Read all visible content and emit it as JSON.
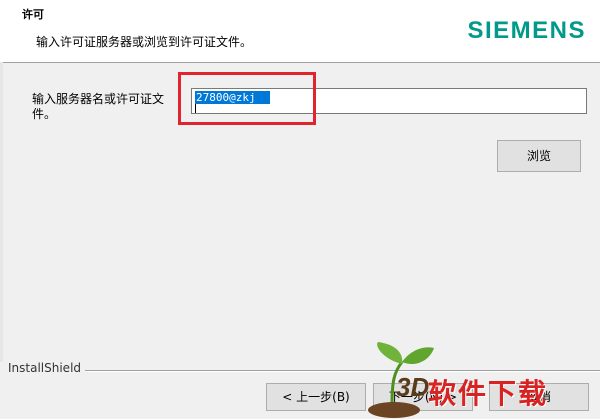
{
  "header": {
    "title": "许可",
    "description": "输入许可证服务器或浏览到许可证文件。",
    "logo": "SIEMENS",
    "logo_color": "#00998a"
  },
  "main": {
    "field_label": "输入服务器名或许可证文件。",
    "server_value": "27800@zkj",
    "browse_label": "浏览",
    "highlight_color": "#e02430"
  },
  "footer": {
    "brand": "InstallShield",
    "back_label": "< 上一步(B)",
    "next_label": "下一步(N) >",
    "cancel_label": "取消"
  },
  "watermark": {
    "text": "3D软件下载",
    "prefix": "3D",
    "suffix": "软件下载"
  }
}
